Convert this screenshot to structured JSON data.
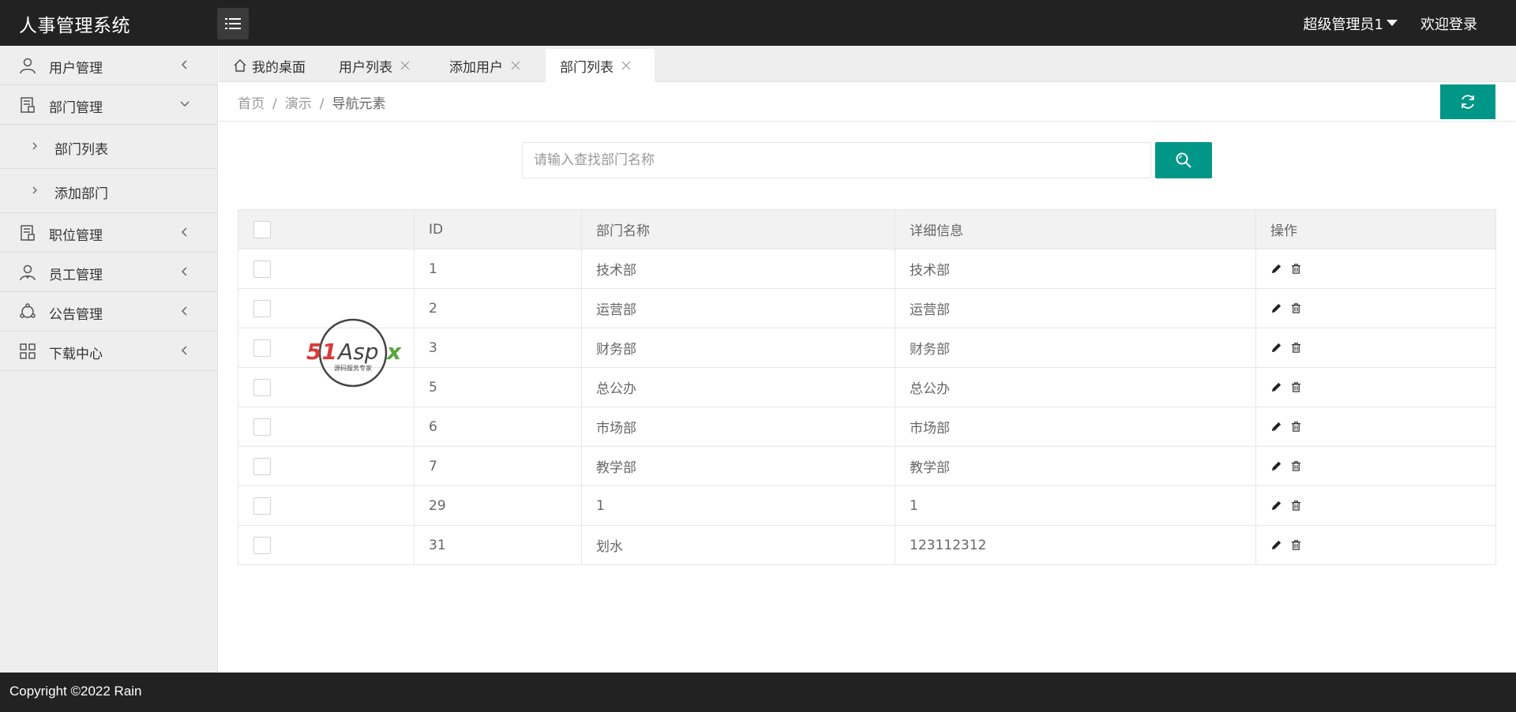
{
  "app": {
    "title": "人事管理系统"
  },
  "header": {
    "user": "超级管理员1",
    "welcome": "欢迎登录"
  },
  "sidebar": {
    "items": [
      {
        "label": "用户管理",
        "icon": "user-icon"
      },
      {
        "label": "部门管理",
        "icon": "document-icon",
        "expanded": true,
        "children": [
          {
            "label": "部门列表"
          },
          {
            "label": "添加部门"
          }
        ]
      },
      {
        "label": "职位管理",
        "icon": "document-icon"
      },
      {
        "label": "员工管理",
        "icon": "employee-icon"
      },
      {
        "label": "公告管理",
        "icon": "announcement-icon"
      },
      {
        "label": "下载中心",
        "icon": "grid-icon"
      }
    ]
  },
  "tabs": [
    {
      "label": "我的桌面",
      "icon": "home-icon"
    },
    {
      "label": "用户列表"
    },
    {
      "label": "添加用户"
    },
    {
      "label": "部门列表",
      "active": true
    }
  ],
  "breadcrumb": [
    "首页",
    "演示",
    "导航元素"
  ],
  "search": {
    "placeholder": "请输入查找部门名称",
    "value": ""
  },
  "table": {
    "columns": [
      "ID",
      "部门名称",
      "详细信息",
      "操作"
    ],
    "rows": [
      {
        "id": "1",
        "name": "技术部",
        "detail": "技术部"
      },
      {
        "id": "2",
        "name": "运营部",
        "detail": "运营部"
      },
      {
        "id": "3",
        "name": "财务部",
        "detail": "财务部"
      },
      {
        "id": "5",
        "name": "总公办",
        "detail": "总公办"
      },
      {
        "id": "6",
        "name": "市场部",
        "detail": "市场部"
      },
      {
        "id": "7",
        "name": "教学部",
        "detail": "教学部"
      },
      {
        "id": "29",
        "name": "1",
        "detail": "1"
      },
      {
        "id": "31",
        "name": "划水",
        "detail": "123112312"
      }
    ]
  },
  "watermark": {
    "text": "51Aspx",
    "subtext": "源码服务专家"
  },
  "footer": {
    "copyright": "Copyright ©2022 Rain"
  },
  "colors": {
    "header": "#222222",
    "accent": "#009688",
    "sidebar": "#eeeeee"
  }
}
